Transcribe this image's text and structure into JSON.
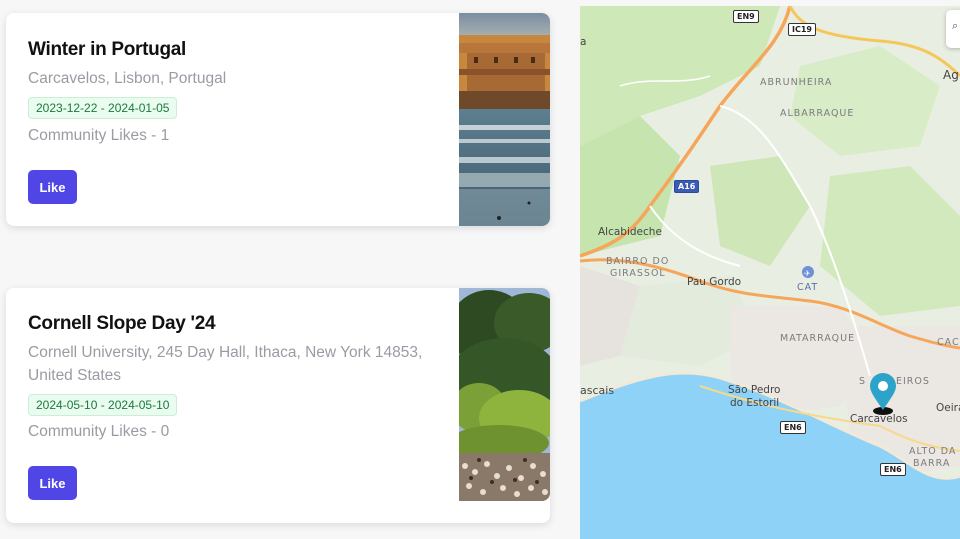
{
  "cards": [
    {
      "title": "Winter in Portugal",
      "location": "Carcavelos, Lisbon, Portugal",
      "dates": "2023-12-22 - 2024-01-05",
      "likes": "Community Likes - 1",
      "like_label": "Like"
    },
    {
      "title": "Cornell Slope Day '24",
      "location_line1": "Cornell University, 245 Day Hall, Ithaca, New York 14853,",
      "location_line2": "United States",
      "dates": "2024-05-10 - 2024-05-10",
      "likes": "Community Likes - 0",
      "like_label": "Like"
    }
  ],
  "map": {
    "places": {
      "abrunheira": "ABRUNHEIRA",
      "albarraque": "ALBARRAQUE",
      "alcabideche": "Alcabideche",
      "bairro1": "BAIRRO DO",
      "bairro2": "GIRASSOL",
      "pau_gordo": "Pau Gordo",
      "cat": "CAT",
      "matarraque": "MATARRAQUE",
      "cascais": "ascais",
      "sao_pedro1": "São Pedro",
      "sao_pedro2": "do Estoril",
      "carcavelos": "Carcavelos",
      "sao_domingos": "S",
      "sao_domingos2": "EIROS",
      "oeiras": "Oeira",
      "alto1": "ALTO DA",
      "alto2": "BARRA",
      "ag": "Ag",
      "cac": "CAC",
      "a_left": "a"
    },
    "roads": {
      "en9": "EN9",
      "ic19": "IC19",
      "a16": "A16",
      "en6a": "EN6",
      "en6b": "EN6"
    },
    "control_glyph": "⌕",
    "colors": {
      "land": "#d6ecc4",
      "water": "#8ed2f7",
      "highway": "#f5a65b",
      "pin": "#2ea3c9"
    }
  }
}
